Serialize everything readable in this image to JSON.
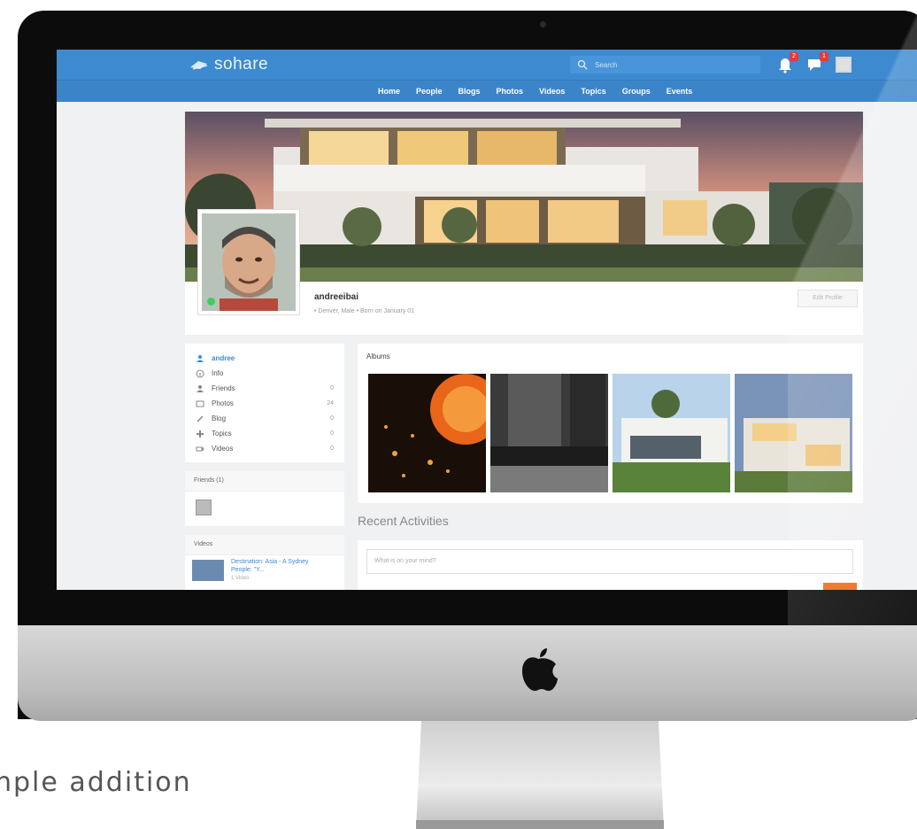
{
  "app": {
    "name": "sohare",
    "search_placeholder": "Search",
    "notification_badge": "2",
    "message_badge": "1"
  },
  "nav": {
    "items": [
      "Home",
      "People",
      "Blogs",
      "Photos",
      "Videos",
      "Topics",
      "Groups",
      "Events"
    ]
  },
  "profile": {
    "name": "andreeibai",
    "meta": "• Denver, Male • Born on January 01",
    "edit_label": "Edit Profile"
  },
  "menu": {
    "items": [
      {
        "label": "andree",
        "count": "",
        "icon": "user-icon"
      },
      {
        "label": "Info",
        "count": "",
        "icon": "info-icon"
      },
      {
        "label": "Friends",
        "count": "0",
        "icon": "friends-icon"
      },
      {
        "label": "Photos",
        "count": "24",
        "icon": "photo-icon"
      },
      {
        "label": "Blog",
        "count": "0",
        "icon": "pencil-icon"
      },
      {
        "label": "Topics",
        "count": "0",
        "icon": "topics-icon"
      },
      {
        "label": "Videos",
        "count": "0",
        "icon": "video-icon"
      }
    ]
  },
  "friends": {
    "title": "Friends (1)"
  },
  "videos": {
    "title": "Videos",
    "item_title": "Destination: Asia - A Sydney People: \"Y...",
    "item_meta": "1 Video"
  },
  "albums": {
    "title": "Albums"
  },
  "activities": {
    "title": "Recent Activities",
    "composer_placeholder": "What is on your mind?"
  },
  "caption": "nple addition",
  "colors": {
    "topbar": "#3d8ad0",
    "nav": "#3b84c8",
    "accent": "#3d8ad0",
    "share_button": "#ef6c1a"
  }
}
